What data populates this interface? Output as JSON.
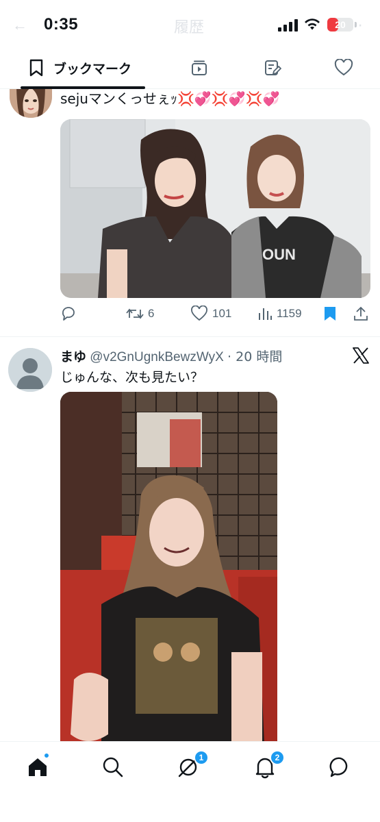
{
  "status_bar": {
    "time": "0:35",
    "battery": "20",
    "battery_level": 0.2,
    "faded_header_title": "履歴",
    "faded_back": "←",
    "faded_more": "⋯"
  },
  "tabs": {
    "bookmark_label": "ブックマーク",
    "icons": [
      "bookmark-icon",
      "video-icon",
      "edit-note-icon",
      "heart-icon"
    ]
  },
  "tweets": [
    {
      "text_prefix": "sejuマンくっせぇｯ",
      "text_emoji": "💢💞💢💞💢💞",
      "more": "⋯",
      "media_description_icons": [
        "photo"
      ],
      "replies_label": "",
      "retweets": "6",
      "likes": "101",
      "views": "1159",
      "bookmarked": true
    },
    {
      "name": "まゆ",
      "handle": "@v2GnUgnkBewzWyX",
      "time": "· 20 時間",
      "text": "じゅんな、次も見たい？"
    }
  ],
  "bottom_nav": {
    "items": [
      "home-icon",
      "search-icon",
      "grok-icon",
      "notifications-icon",
      "messages-icon"
    ],
    "grok_badge": "1",
    "notifications_badge": "2"
  },
  "colors": {
    "accent": "#1d9bf0",
    "text": "#0f1419",
    "muted": "#536471",
    "battery_low": "#ef3a40"
  }
}
